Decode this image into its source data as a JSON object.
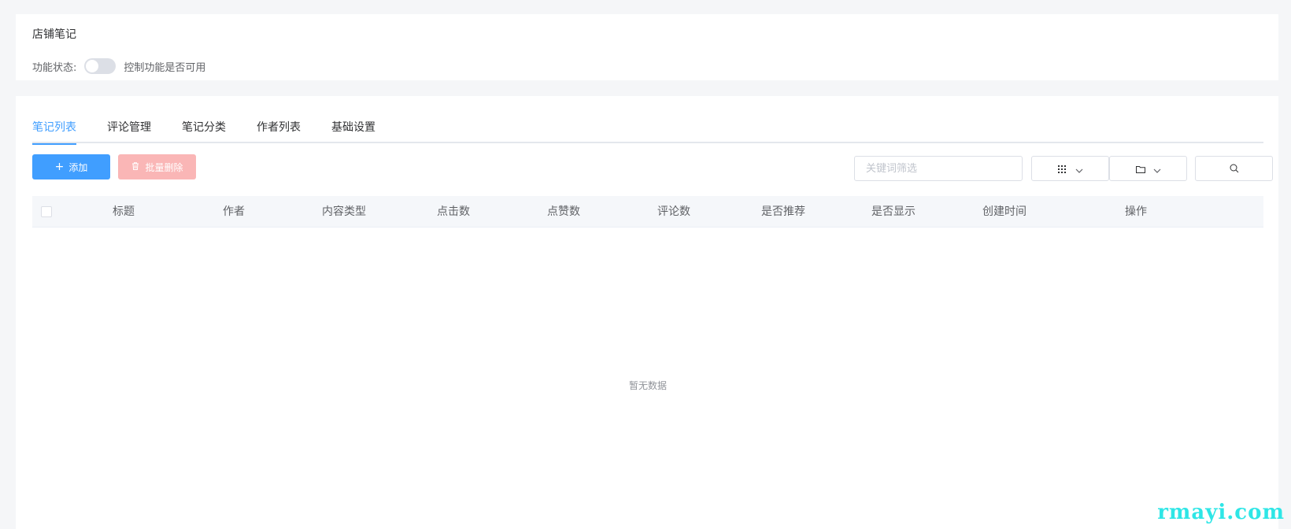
{
  "header": {
    "title": "店铺笔记",
    "status_label": "功能状态:",
    "status_enabled": false,
    "status_hint": "控制功能是否可用"
  },
  "tabs": [
    {
      "label": "笔记列表",
      "active": true
    },
    {
      "label": "评论管理",
      "active": false
    },
    {
      "label": "笔记分类",
      "active": false
    },
    {
      "label": "作者列表",
      "active": false
    },
    {
      "label": "基础设置",
      "active": false
    }
  ],
  "toolbar": {
    "add_label": "添加",
    "batch_delete_label": "批量删除",
    "keyword_placeholder": "关键词筛选"
  },
  "table": {
    "columns": [
      "标题",
      "作者",
      "内容类型",
      "点击数",
      "点赞数",
      "评论数",
      "是否推荐",
      "是否显示",
      "创建时间",
      "操作"
    ],
    "empty_text": "暂无数据"
  },
  "watermark": "rmayi.com",
  "colors": {
    "primary": "#409eff",
    "danger_disabled": "#fab6b6",
    "watermark": "#2ee6e6"
  }
}
